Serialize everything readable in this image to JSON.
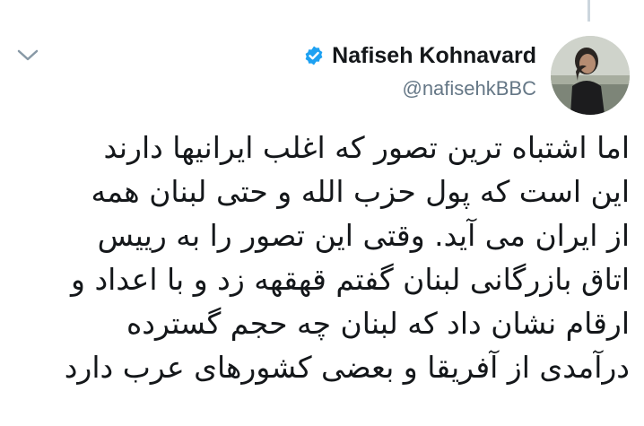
{
  "tweet": {
    "author": {
      "display_name": "Nafiseh Kohnavard",
      "handle": "@nafisehkBBC",
      "verified": true,
      "avatar_icon": "profile-photo"
    },
    "menu_icon": "chevron-down-icon",
    "verified_icon": "verified-badge-icon",
    "accent_color": "#1da1f2",
    "body_lines": [
      "اما اشتباه ترین تصور که اغلب ایرانیها دارند",
      "این است که پول حزب الله و حتی لبنان همه",
      "از ایران می آید. وقتی این تصور را به رییس",
      "اتاق بازرگانی لبنان گفتم قهقهه زد و با اعداد و",
      "ارقام نشان داد که لبنان چه حجم گسترده",
      "درآمدی از آفریقا و بعضی کشورهای عرب دارد"
    ]
  }
}
